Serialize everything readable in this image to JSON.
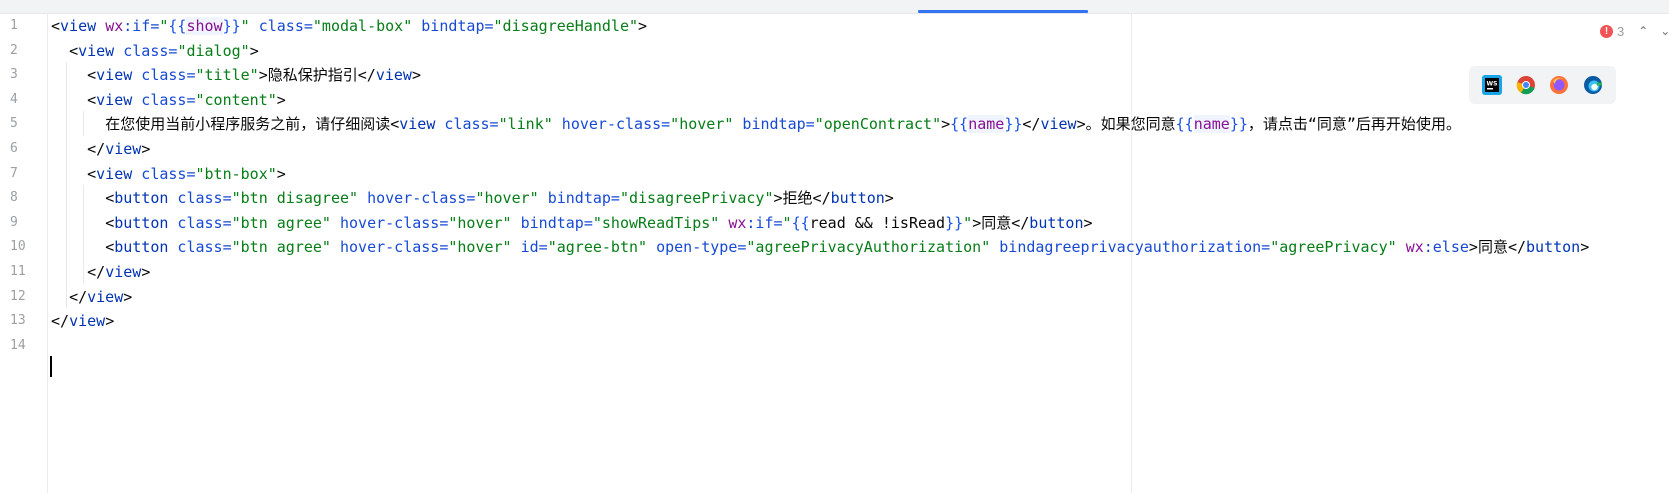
{
  "editor": {
    "problems": {
      "count": "3",
      "up_icon": "chevron-up-icon",
      "down_icon": "chevron-down-icon"
    },
    "browsers": [
      "webstorm-icon",
      "chrome-icon",
      "firefox-icon",
      "edge-icon"
    ],
    "lines": [
      {
        "num": "1",
        "tokens": [
          {
            "t": "<",
            "k": "punc"
          },
          {
            "t": "view",
            "k": "tag"
          },
          {
            "t": " ",
            "k": "text"
          },
          {
            "t": "wx",
            "k": "wx"
          },
          {
            "t": ":if=",
            "k": "attr"
          },
          {
            "t": "\"",
            "k": "str"
          },
          {
            "t": "{{",
            "k": "mus"
          },
          {
            "t": "show",
            "k": "var"
          },
          {
            "t": "}}",
            "k": "mus"
          },
          {
            "t": "\"",
            "k": "str"
          },
          {
            "t": " class=",
            "k": "attr"
          },
          {
            "t": "\"modal-box\"",
            "k": "str"
          },
          {
            "t": " bindtap=",
            "k": "attr"
          },
          {
            "t": "\"disagreeHandle\"",
            "k": "str"
          },
          {
            "t": ">",
            "k": "punc"
          }
        ]
      },
      {
        "num": "2",
        "tokens": [
          {
            "t": "  ",
            "k": "text"
          },
          {
            "t": "<",
            "k": "punc"
          },
          {
            "t": "view",
            "k": "tag"
          },
          {
            "t": " class=",
            "k": "attr"
          },
          {
            "t": "\"dialog\"",
            "k": "str"
          },
          {
            "t": ">",
            "k": "punc"
          }
        ]
      },
      {
        "num": "3",
        "tokens": [
          {
            "t": "    ",
            "k": "text"
          },
          {
            "t": "<",
            "k": "punc"
          },
          {
            "t": "view",
            "k": "tag"
          },
          {
            "t": " class=",
            "k": "attr"
          },
          {
            "t": "\"title\"",
            "k": "str"
          },
          {
            "t": ">",
            "k": "punc"
          },
          {
            "t": "隐私保护指引",
            "k": "text"
          },
          {
            "t": "</",
            "k": "punc"
          },
          {
            "t": "view",
            "k": "tag"
          },
          {
            "t": ">",
            "k": "punc"
          }
        ]
      },
      {
        "num": "4",
        "tokens": [
          {
            "t": "    ",
            "k": "text"
          },
          {
            "t": "<",
            "k": "punc"
          },
          {
            "t": "view",
            "k": "tag"
          },
          {
            "t": " class=",
            "k": "attr"
          },
          {
            "t": "\"content\"",
            "k": "str"
          },
          {
            "t": ">",
            "k": "punc"
          }
        ]
      },
      {
        "num": "5",
        "tokens": [
          {
            "t": "      ",
            "k": "text"
          },
          {
            "t": "在您使用当前小程序服务之前，请仔细阅读",
            "k": "text"
          },
          {
            "t": "<",
            "k": "punc"
          },
          {
            "t": "view",
            "k": "tag"
          },
          {
            "t": " class=",
            "k": "attr"
          },
          {
            "t": "\"link\"",
            "k": "str"
          },
          {
            "t": " hover-class=",
            "k": "attr"
          },
          {
            "t": "\"hover\"",
            "k": "str"
          },
          {
            "t": " bindtap=",
            "k": "attr"
          },
          {
            "t": "\"openContract\"",
            "k": "str"
          },
          {
            "t": ">",
            "k": "punc"
          },
          {
            "t": "{{",
            "k": "mus"
          },
          {
            "t": "name",
            "k": "var"
          },
          {
            "t": "}}",
            "k": "mus"
          },
          {
            "t": "</",
            "k": "punc"
          },
          {
            "t": "view",
            "k": "tag"
          },
          {
            "t": ">",
            "k": "punc"
          },
          {
            "t": "。如果您同意",
            "k": "text"
          },
          {
            "t": "{{",
            "k": "mus"
          },
          {
            "t": "name",
            "k": "var"
          },
          {
            "t": "}}",
            "k": "mus"
          },
          {
            "t": "，请点击“同意”后再开始使用。",
            "k": "text"
          }
        ]
      },
      {
        "num": "6",
        "tokens": [
          {
            "t": "    ",
            "k": "text"
          },
          {
            "t": "</",
            "k": "punc"
          },
          {
            "t": "view",
            "k": "tag"
          },
          {
            "t": ">",
            "k": "punc"
          }
        ]
      },
      {
        "num": "7",
        "tokens": [
          {
            "t": "    ",
            "k": "text"
          },
          {
            "t": "<",
            "k": "punc"
          },
          {
            "t": "view",
            "k": "tag"
          },
          {
            "t": " class=",
            "k": "attr"
          },
          {
            "t": "\"btn-box\"",
            "k": "str"
          },
          {
            "t": ">",
            "k": "punc"
          }
        ]
      },
      {
        "num": "8",
        "tokens": [
          {
            "t": "      ",
            "k": "text"
          },
          {
            "t": "<",
            "k": "punc"
          },
          {
            "t": "button",
            "k": "tag"
          },
          {
            "t": " class=",
            "k": "attr"
          },
          {
            "t": "\"btn disagree\"",
            "k": "str"
          },
          {
            "t": " hover-class=",
            "k": "attr"
          },
          {
            "t": "\"hover\"",
            "k": "str"
          },
          {
            "t": " bindtap=",
            "k": "attr"
          },
          {
            "t": "\"disagreePrivacy\"",
            "k": "str"
          },
          {
            "t": ">",
            "k": "punc"
          },
          {
            "t": "拒绝",
            "k": "text"
          },
          {
            "t": "</",
            "k": "punc"
          },
          {
            "t": "button",
            "k": "tag"
          },
          {
            "t": ">",
            "k": "punc"
          }
        ]
      },
      {
        "num": "9",
        "tokens": [
          {
            "t": "      ",
            "k": "text"
          },
          {
            "t": "<",
            "k": "punc"
          },
          {
            "t": "button",
            "k": "tag"
          },
          {
            "t": " class=",
            "k": "attr"
          },
          {
            "t": "\"btn agree\"",
            "k": "str"
          },
          {
            "t": " hover-class=",
            "k": "attr"
          },
          {
            "t": "\"hover\"",
            "k": "str"
          },
          {
            "t": " bindtap=",
            "k": "attr"
          },
          {
            "t": "\"showReadTips\"",
            "k": "str"
          },
          {
            "t": " ",
            "k": "text"
          },
          {
            "t": "wx",
            "k": "wx"
          },
          {
            "t": ":if=",
            "k": "attr"
          },
          {
            "t": "\"",
            "k": "str"
          },
          {
            "t": "{{",
            "k": "mus"
          },
          {
            "t": "read && !isRead",
            "k": "text"
          },
          {
            "t": "}}",
            "k": "mus"
          },
          {
            "t": "\"",
            "k": "str"
          },
          {
            "t": ">",
            "k": "punc"
          },
          {
            "t": "同意",
            "k": "text"
          },
          {
            "t": "</",
            "k": "punc"
          },
          {
            "t": "button",
            "k": "tag"
          },
          {
            "t": ">",
            "k": "punc"
          }
        ]
      },
      {
        "num": "10",
        "tokens": [
          {
            "t": "      ",
            "k": "text"
          },
          {
            "t": "<",
            "k": "punc"
          },
          {
            "t": "button",
            "k": "tag"
          },
          {
            "t": " class=",
            "k": "attr"
          },
          {
            "t": "\"btn agree\"",
            "k": "str"
          },
          {
            "t": " hover-class=",
            "k": "attr"
          },
          {
            "t": "\"hover\"",
            "k": "str"
          },
          {
            "t": " id=",
            "k": "attr"
          },
          {
            "t": "\"agree-btn\"",
            "k": "str"
          },
          {
            "t": " open-type=",
            "k": "attr"
          },
          {
            "t": "\"agreePrivacyAuthorization\"",
            "k": "str"
          },
          {
            "t": " bindagreeprivacyauthorization=",
            "k": "attr"
          },
          {
            "t": "\"agreePrivacy\"",
            "k": "str"
          },
          {
            "t": " ",
            "k": "text"
          },
          {
            "t": "wx",
            "k": "wx"
          },
          {
            "t": ":else",
            "k": "attr"
          },
          {
            "t": ">",
            "k": "punc"
          },
          {
            "t": "同意",
            "k": "text"
          },
          {
            "t": "</",
            "k": "punc"
          },
          {
            "t": "button",
            "k": "tag"
          },
          {
            "t": ">",
            "k": "punc"
          }
        ]
      },
      {
        "num": "11",
        "tokens": [
          {
            "t": "    ",
            "k": "text"
          },
          {
            "t": "</",
            "k": "punc"
          },
          {
            "t": "view",
            "k": "tag"
          },
          {
            "t": ">",
            "k": "punc"
          }
        ]
      },
      {
        "num": "12",
        "tokens": [
          {
            "t": "  ",
            "k": "text"
          },
          {
            "t": "</",
            "k": "punc"
          },
          {
            "t": "view",
            "k": "tag"
          },
          {
            "t": ">",
            "k": "punc"
          }
        ]
      },
      {
        "num": "13",
        "tokens": [
          {
            "t": "</",
            "k": "punc"
          },
          {
            "t": "view",
            "k": "tag"
          },
          {
            "t": ">",
            "k": "punc"
          }
        ]
      },
      {
        "num": "14",
        "tokens": []
      }
    ]
  }
}
